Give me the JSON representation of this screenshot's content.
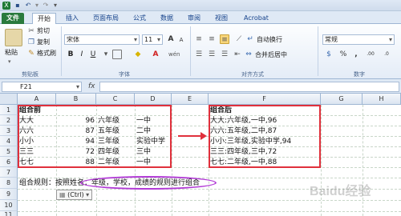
{
  "quick_access": [
    "Excel",
    "Save",
    "Undo",
    "Redo",
    "Customize"
  ],
  "tabs": [
    "文件",
    "开始",
    "插入",
    "页面布局",
    "公式",
    "数据",
    "审阅",
    "视图",
    "Acrobat"
  ],
  "active_tab": "开始",
  "ribbon": {
    "clipboard": {
      "paste": "粘贴",
      "cut": "剪切",
      "copy": "复制",
      "painter": "格式刷",
      "label": "剪贴板"
    },
    "font": {
      "name": "宋体",
      "size": "11",
      "bold": "B",
      "italic": "I",
      "underline": "U",
      "grow": "A",
      "shrink": "A",
      "label": "字体",
      "wen": "wén"
    },
    "alignment": {
      "wrap": "自动换行",
      "merge": "合并后居中",
      "label": "对齐方式"
    },
    "number": {
      "format": "常规",
      "label": "数字",
      "currency": "$",
      "percent": "%",
      "comma": ",",
      "inc": ".00",
      "dec": ".0"
    }
  },
  "formula_bar": {
    "name_box": "F21",
    "fx": "fx",
    "value": ""
  },
  "columns": [
    "A",
    "B",
    "C",
    "D",
    "E",
    "F",
    "G",
    "H"
  ],
  "rows": [
    "1",
    "2",
    "3",
    "4",
    "5",
    "6",
    "7",
    "8",
    "9",
    "10",
    "11"
  ],
  "table_before": {
    "title": "组合前",
    "rows": [
      {
        "name": "大大",
        "score": "96",
        "grade": "六年级",
        "school": "一中"
      },
      {
        "name": "六六",
        "score": "87",
        "grade": "五年级",
        "school": "二中"
      },
      {
        "name": "小小",
        "score": "94",
        "grade": "三年级",
        "school": "实验中学"
      },
      {
        "name": "三三",
        "score": "72",
        "grade": "四年级",
        "school": "三中"
      },
      {
        "name": "七七",
        "score": "88",
        "grade": "二年级",
        "school": "一中"
      }
    ]
  },
  "table_after": {
    "title": "组合后",
    "rows": [
      "大大:六年级,一中,96",
      "六六:五年级,二中,87",
      "小小:三年级,实验中学,94",
      "三三:四年级,三中,72",
      "七七:二年级,一中,88"
    ]
  },
  "rule_text": "组合规则：按照姓名：年级，学校，成绩的规则进行组合",
  "paste_options": "(Ctrl)",
  "watermark": "Baidu经验",
  "colors": {
    "accent_red": "#e0303c",
    "ellipse": "#b23bd6",
    "file_tab": "#2a7a3d"
  }
}
